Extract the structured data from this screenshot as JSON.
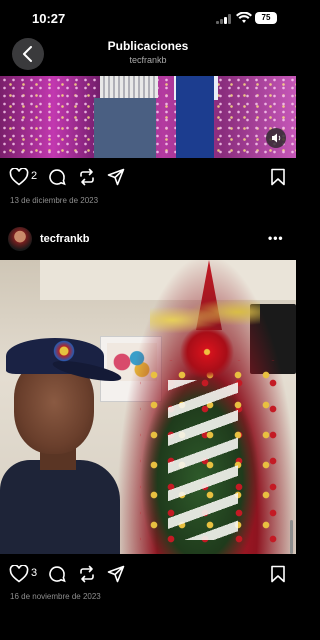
{
  "status": {
    "time": "10:27",
    "battery": "75"
  },
  "header": {
    "title": "Publicaciones",
    "subtitle": "tecfrankb"
  },
  "posts": [
    {
      "likes": "2",
      "date": "13 de diciembre de 2023"
    },
    {
      "username": "tecfrankb",
      "likes": "3",
      "date": "16 de noviembre de 2023"
    }
  ],
  "icons": [
    "back-chevron-icon",
    "heart-icon",
    "comment-icon",
    "repost-icon",
    "share-icon",
    "bookmark-icon",
    "sound-icon",
    "more-icon"
  ]
}
